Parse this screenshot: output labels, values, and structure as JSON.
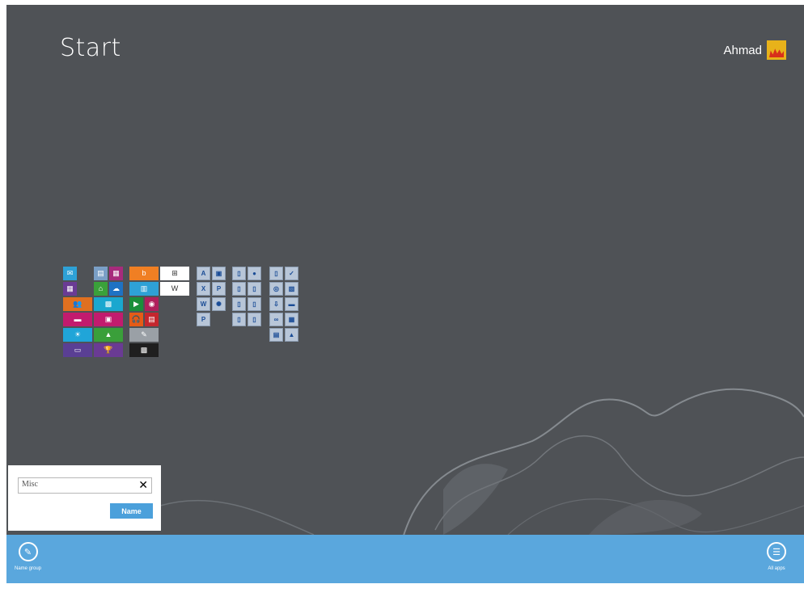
{
  "screen": {
    "title": "Start"
  },
  "user": {
    "name": "Ahmad",
    "avatar_icon": "flame-icon"
  },
  "tiles": [
    {
      "id": "mail",
      "name": "tile-mail",
      "color": "#2ea1d6",
      "glyph": "✉"
    },
    {
      "id": "news",
      "name": "tile-news",
      "color": "#7a9fc6",
      "glyph": "▤"
    },
    {
      "id": "maps",
      "name": "tile-maps",
      "color": "#a72b7c",
      "glyph": "▦"
    },
    {
      "id": "bing",
      "name": "tile-bing",
      "color": "#f07f23",
      "glyph": "b"
    },
    {
      "id": "store-w",
      "name": "tile-windows",
      "color": "#ffffff",
      "glyph": "⊞"
    },
    {
      "id": "acc-a",
      "name": "tile-access",
      "color": "#c0c8d2",
      "glyph": "A"
    },
    {
      "id": "acc-b",
      "name": "tile-picture",
      "color": "#c0c8d2",
      "glyph": "▣"
    },
    {
      "id": "d1",
      "name": "tile-document",
      "color": "#c0c8d2",
      "glyph": "▯"
    },
    {
      "id": "firefox",
      "name": "tile-firefox",
      "color": "#c0c8d2",
      "glyph": "●"
    },
    {
      "id": "e1",
      "name": "tile-file",
      "color": "#c0c8d2",
      "glyph": "▯"
    },
    {
      "id": "check",
      "name": "tile-check",
      "color": "#c0c8d2",
      "glyph": "✓"
    },
    {
      "id": "cal",
      "name": "tile-calendar",
      "color": "#6a3b94",
      "glyph": "▦"
    },
    {
      "id": "store",
      "name": "tile-store",
      "color": "#3aa13a",
      "glyph": "⌂"
    },
    {
      "id": "skydrive",
      "name": "tile-skydrive",
      "color": "#1e72c4",
      "glyph": "☁"
    },
    {
      "id": "photos-top",
      "name": "tile-photos",
      "color": "#2ea1d6",
      "glyph": "▥"
    },
    {
      "id": "wiki",
      "name": "tile-wikipedia",
      "color": "#ffffff",
      "glyph": "W"
    },
    {
      "id": "excel",
      "name": "tile-excel",
      "color": "#c0c8d2",
      "glyph": "X"
    },
    {
      "id": "pp",
      "name": "tile-powerpoint",
      "color": "#c0c8d2",
      "glyph": "P"
    },
    {
      "id": "d2",
      "name": "tile-document-2",
      "color": "#c0c8d2",
      "glyph": "▯"
    },
    {
      "id": "d3",
      "name": "tile-document-3",
      "color": "#c0c8d2",
      "glyph": "▯"
    },
    {
      "id": "net",
      "name": "tile-network",
      "color": "#c0c8d2",
      "glyph": "◎"
    },
    {
      "id": "img2",
      "name": "tile-image",
      "color": "#c0c8d2",
      "glyph": "▧"
    },
    {
      "id": "people",
      "name": "tile-people",
      "color": "#e07020",
      "glyph": "👥"
    },
    {
      "id": "photos",
      "name": "tile-photos-2",
      "color": "#1aa7cf",
      "glyph": "▩"
    },
    {
      "id": "games",
      "name": "tile-games",
      "color": "#1a8f3a",
      "glyph": "▶"
    },
    {
      "id": "camera",
      "name": "tile-camera",
      "color": "#b0205c",
      "glyph": "◉"
    },
    {
      "id": "word",
      "name": "tile-word",
      "color": "#c0c8d2",
      "glyph": "W"
    },
    {
      "id": "sun",
      "name": "tile-sun",
      "color": "#c0c8d2",
      "glyph": "✺"
    },
    {
      "id": "f1",
      "name": "tile-folder",
      "color": "#c0c8d2",
      "glyph": "▯"
    },
    {
      "id": "f2",
      "name": "tile-folder-2",
      "color": "#c0c8d2",
      "glyph": "▯"
    },
    {
      "id": "dl",
      "name": "tile-download",
      "color": "#c0c8d2",
      "glyph": "⇩"
    },
    {
      "id": "cmd",
      "name": "tile-console",
      "color": "#c0c8d2",
      "glyph": "▬"
    },
    {
      "id": "messaging",
      "name": "tile-messaging",
      "color": "#c21b6e",
      "glyph": "▬"
    },
    {
      "id": "video",
      "name": "tile-video",
      "color": "#c21b6e",
      "glyph": "▣"
    },
    {
      "id": "music",
      "name": "tile-music",
      "color": "#e65b16",
      "glyph": "🎧"
    },
    {
      "id": "reader",
      "name": "tile-reader",
      "color": "#c4262e",
      "glyph": "▤"
    },
    {
      "id": "pub",
      "name": "tile-publisher",
      "color": "#c0c8d2",
      "glyph": "P"
    },
    {
      "id": "f3",
      "name": "tile-file-3",
      "color": "#c0c8d2",
      "glyph": "▯"
    },
    {
      "id": "f4",
      "name": "tile-file-4",
      "color": "#c0c8d2",
      "glyph": "▯"
    },
    {
      "id": "vs",
      "name": "tile-visual-studio",
      "color": "#c0c8d2",
      "glyph": "∞"
    },
    {
      "id": "sheet",
      "name": "tile-sheet",
      "color": "#c0c8d2",
      "glyph": "▦"
    },
    {
      "id": "weather",
      "name": "tile-weather",
      "color": "#20a5d8",
      "glyph": "☀"
    },
    {
      "id": "finance",
      "name": "tile-finance",
      "color": "#3a9f3a",
      "glyph": "▲"
    },
    {
      "id": "sticky",
      "name": "tile-sticky-notes",
      "color": "#9aa0a6",
      "glyph": "✎"
    },
    {
      "id": "ctrl",
      "name": "tile-control-panel",
      "color": "#c0c8d2",
      "glyph": "▤"
    },
    {
      "id": "paint",
      "name": "tile-paint",
      "color": "#c0c8d2",
      "glyph": "▲"
    },
    {
      "id": "desktop",
      "name": "tile-desktop",
      "color": "#5a3f94",
      "glyph": "▭"
    },
    {
      "id": "sports",
      "name": "tile-sports",
      "color": "#6a3b94",
      "glyph": "🏆"
    },
    {
      "id": "notes",
      "name": "tile-notes",
      "color": "#1f1f1f",
      "glyph": "▩"
    }
  ],
  "name_group": {
    "input_value": "Misc",
    "clear_glyph": "✕",
    "button_label": "Name"
  },
  "appbar": {
    "name_group_label": "Name group",
    "name_group_icon": "pencil-icon",
    "all_apps_label": "All apps",
    "all_apps_icon": "list-icon"
  },
  "colors": {
    "background": "#4f5256",
    "appbar": "#5aa7dd",
    "accent": "#4ba0db"
  }
}
